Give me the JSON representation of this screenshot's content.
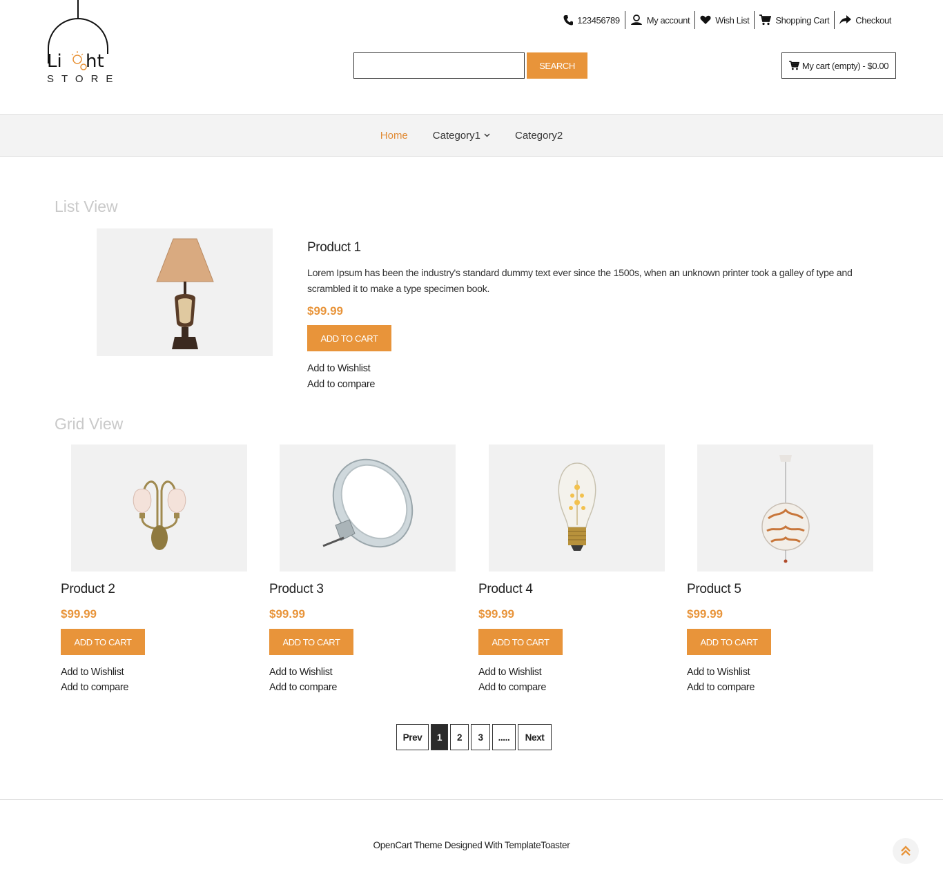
{
  "brand": {
    "logo_text": "Light",
    "logo_subtext": "STORE"
  },
  "header": {
    "links": [
      {
        "label": "123456789",
        "icon": "phone-icon"
      },
      {
        "label": "My account",
        "icon": "user-icon"
      },
      {
        "label": "Wish List",
        "icon": "heart-icon"
      },
      {
        "label": "Shopping Cart",
        "icon": "cart-icon"
      },
      {
        "label": "Checkout",
        "icon": "share-arrow-icon"
      }
    ],
    "search": {
      "value": "",
      "placeholder": "",
      "button_label": "SEARCH"
    },
    "mini_cart_label": "My cart (empty) - $0.00"
  },
  "nav": {
    "items": [
      {
        "label": "Home"
      },
      {
        "label": "Category1"
      },
      {
        "label": "Category2"
      }
    ]
  },
  "list_view": {
    "title": "List View",
    "product": {
      "name": "Product 1",
      "description": "Lorem Ipsum has been the industry's standard dummy text ever since the 1500s, when an unknown printer took a galley of type and scrambled it to make a type specimen book.",
      "price": "$99.99",
      "cart_label": "ADD TO CART",
      "wishlist_label": "Add to Wishlist",
      "compare_label": "Add to compare"
    }
  },
  "grid_view": {
    "title": "Grid View",
    "products": [
      {
        "name": "Product 2",
        "price": "$99.99",
        "cart_label": "ADD TO CART",
        "wishlist_label": "Add to Wishlist",
        "compare_label": "Add to compare"
      },
      {
        "name": "Product 3",
        "price": "$99.99",
        "cart_label": "ADD TO CART",
        "wishlist_label": "Add to Wishlist",
        "compare_label": "Add to compare"
      },
      {
        "name": "Product 4",
        "price": "$99.99",
        "cart_label": "ADD TO CART",
        "wishlist_label": "Add to Wishlist",
        "compare_label": "Add to compare"
      },
      {
        "name": "Product 5",
        "price": "$99.99",
        "cart_label": "ADD TO CART",
        "wishlist_label": "Add to Wishlist",
        "compare_label": "Add to compare"
      }
    ]
  },
  "pagination": {
    "prev": "Prev",
    "pages": [
      "1",
      "2",
      "3",
      "....."
    ],
    "next": "Next",
    "current": "1"
  },
  "footer": {
    "text": "OpenCart Theme Designed With TemplateToaster"
  },
  "colors": {
    "accent": "#e8943a",
    "nav_bg": "#f3f3f3",
    "image_bg": "#f1f1f1"
  }
}
